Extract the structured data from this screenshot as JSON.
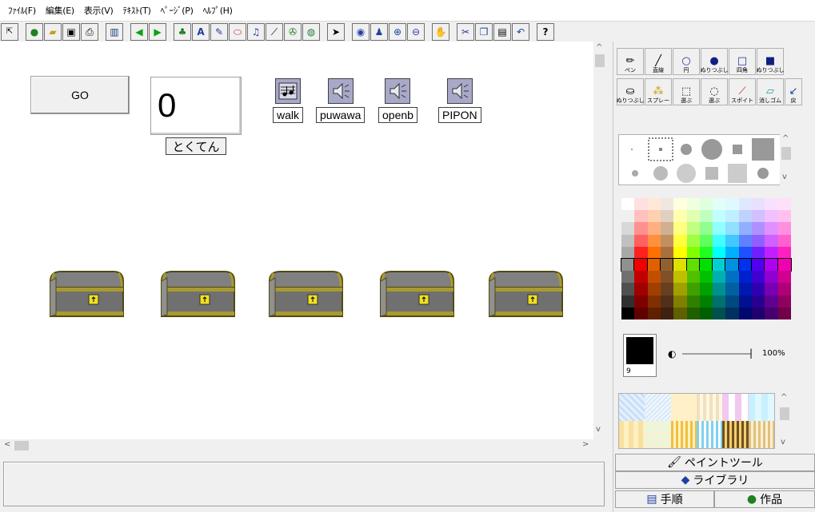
{
  "menu": [
    "ﾌｧｲﾙ(F)",
    "編集(E)",
    "表示(V)",
    "ﾃｷｽﾄ(T)",
    "ﾍﾟｰｼﾞ(P)",
    "ﾍﾙﾌﾟ(H)"
  ],
  "toolbar": {
    "help_label": "?"
  },
  "canvas": {
    "go_label": "GO",
    "score_value": "0",
    "score_label": "とくてん",
    "sounds": [
      {
        "label": "walk",
        "icon": "music-score-icon"
      },
      {
        "label": "puwawa",
        "icon": "speaker-icon"
      },
      {
        "label": "openb",
        "icon": "speaker-icon"
      },
      {
        "label": "PIPON",
        "icon": "speaker-icon"
      }
    ],
    "chest_count": 5
  },
  "tools": {
    "row1": [
      "ペン",
      "直線",
      "円",
      "ぬりつぶし",
      "四角",
      "ぬりつぶし"
    ],
    "row2": [
      "ぬりつぶし",
      "スプレー",
      "選ぶ",
      "選ぶ",
      "スポイト",
      "消しゴム",
      "戻"
    ]
  },
  "color": {
    "selected_number": "9",
    "opacity": "100%"
  },
  "tabs": {
    "paint_tool": "ペイントツール",
    "library": "ライブラリ",
    "procedure": "手順",
    "works": "作品"
  }
}
